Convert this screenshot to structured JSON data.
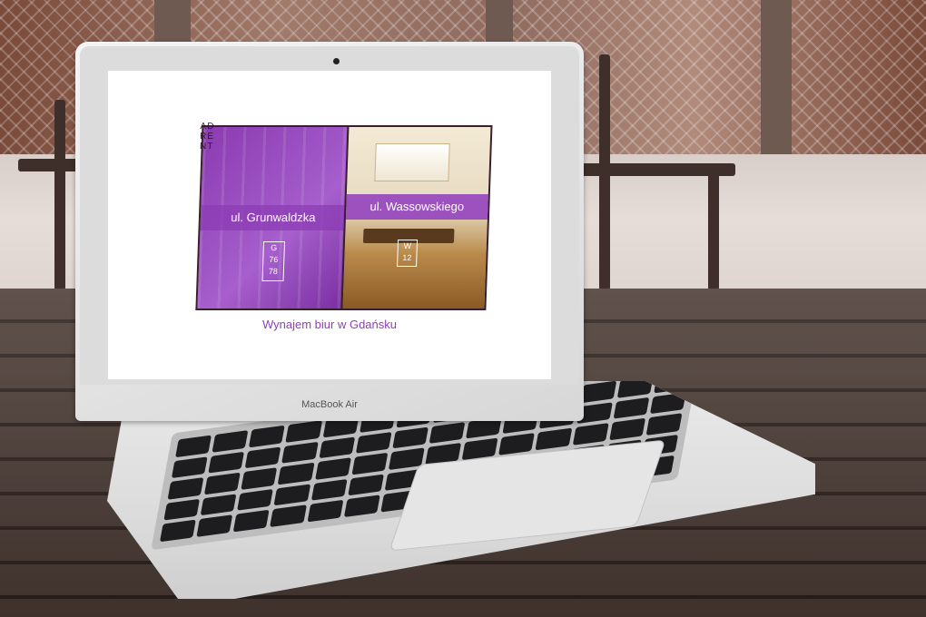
{
  "device": {
    "label": "MacBook Air"
  },
  "website": {
    "brand": "ADRENT",
    "locations": [
      {
        "name": "ul. Grunwaldzka",
        "badge_letter": "G",
        "badge_numbers": "76 78"
      },
      {
        "name": "ul. Wassowskiego",
        "badge_letter": "W",
        "badge_numbers": "12"
      }
    ],
    "tagline": "Wynajem biur w Gdańsku"
  },
  "colors": {
    "brand_purple": "#8e3fb3",
    "panel_purple": "#a65fcc"
  }
}
